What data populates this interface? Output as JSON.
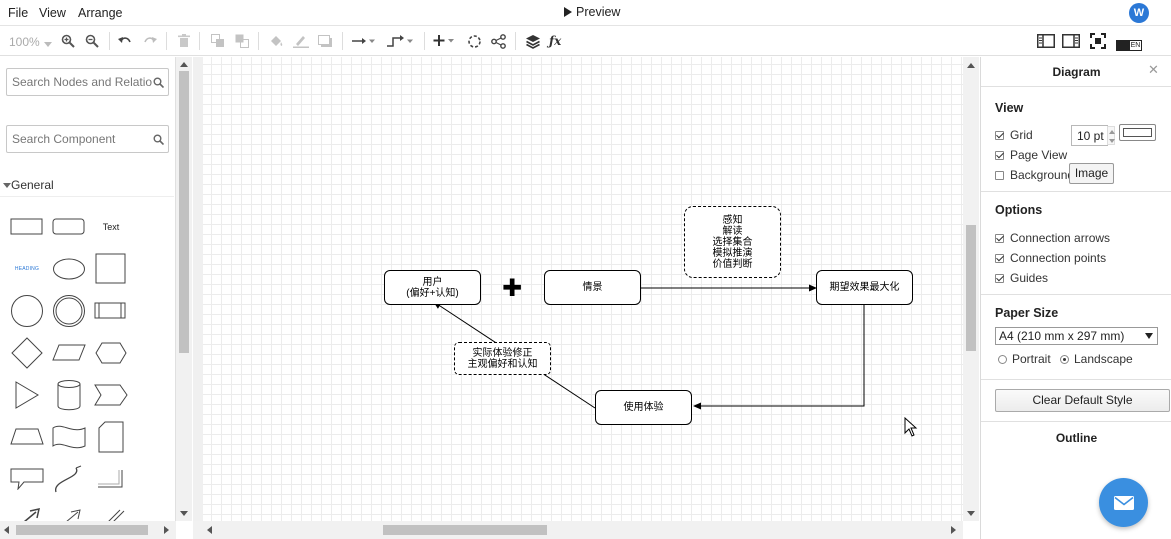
{
  "menubar": {
    "items": [
      "File",
      "View",
      "Arrange"
    ],
    "preview_label": "Preview",
    "avatar_initial": "W"
  },
  "toolbar": {
    "zoom": "100%",
    "view_toggle_label": "EN"
  },
  "sidebar": {
    "search_nodes_placeholder": "Search Nodes and Relations",
    "search_component_placeholder": "Search Component",
    "section_title": "General",
    "text_shape_label": "Text",
    "heading_shape_label": "HEADING"
  },
  "diagram": {
    "nodes": {
      "user": "用户\n(偏好+认知)",
      "scene": "情景",
      "expectation": "期望效果最大化",
      "experience": "使用体验",
      "cognition": "感知\n解读\n选择集合\n模拟推演\n价值判断",
      "correction": "实际体验修正\n主观偏好和认知"
    },
    "plus": "✚"
  },
  "format_panel": {
    "title": "Diagram",
    "view": {
      "title": "View",
      "grid_label": "Grid",
      "grid_checked": true,
      "grid_size": "10 pt",
      "page_view_label": "Page View",
      "page_view_checked": true,
      "background_label": "Background",
      "background_checked": false,
      "image_button": "Image"
    },
    "options": {
      "title": "Options",
      "connection_arrows": "Connection arrows",
      "connection_points": "Connection points",
      "guides": "Guides"
    },
    "paper": {
      "title": "Paper Size",
      "selected": "A4 (210 mm x 297 mm)",
      "portrait": "Portrait",
      "landscape": "Landscape",
      "orientation": "Landscape"
    },
    "clear_button": "Clear Default Style",
    "outline_title": "Outline"
  },
  "colors": {
    "accent": "#2b78d6",
    "fab": "#3a8fe0"
  }
}
